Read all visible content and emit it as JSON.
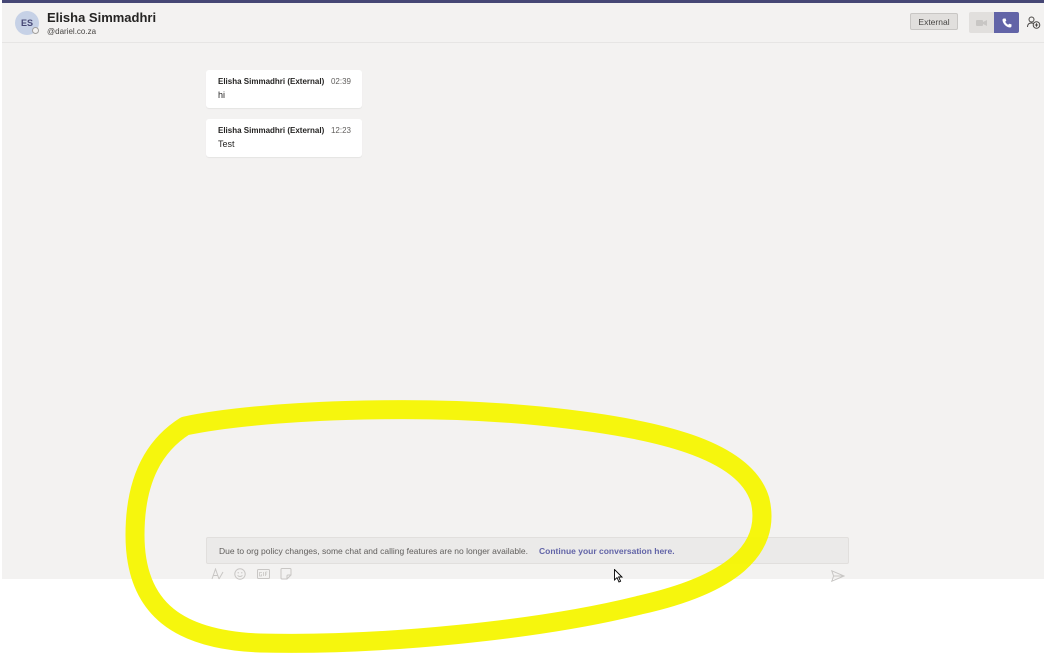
{
  "header": {
    "avatar_initials": "ES",
    "contact_name": "Elisha Simmadhri",
    "contact_handle": "@dariel.co.za",
    "external_badge": "External"
  },
  "messages": [
    {
      "author": "Elisha Simmadhri (External)",
      "time": "02:39",
      "text": "hi"
    },
    {
      "author": "Elisha Simmadhri (External)",
      "time": "12:23",
      "text": "Test"
    }
  ],
  "notice": {
    "text": "Due to org policy changes, some chat and calling features are no longer available.",
    "link": "Continue your conversation here."
  },
  "colors": {
    "accent": "#6264a7",
    "background": "#f3f2f1",
    "highlight": "#f5f500"
  },
  "icons": {
    "video": "video-camera-icon",
    "call": "phone-icon",
    "people": "add-people-icon",
    "format": "format-icon",
    "emoji": "emoji-icon",
    "gif": "gif-icon",
    "sticker": "sticker-icon",
    "send": "send-icon"
  }
}
